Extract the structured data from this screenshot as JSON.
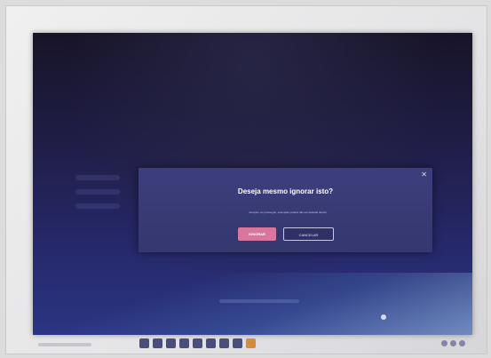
{
  "dialog": {
    "title": "Deseja mesmo ignorar isto?",
    "body": "Atenção: ao prosseguir, esta ação poderá não ser desfeita depois.",
    "confirm_label": "IGNORAR",
    "cancel_label": "CANCELAR",
    "close_icon": "close-icon"
  },
  "colors": {
    "dialog_bg": "#3a3b77",
    "confirm_button": "#d8769e",
    "screen_bg": "#1f1d45"
  }
}
